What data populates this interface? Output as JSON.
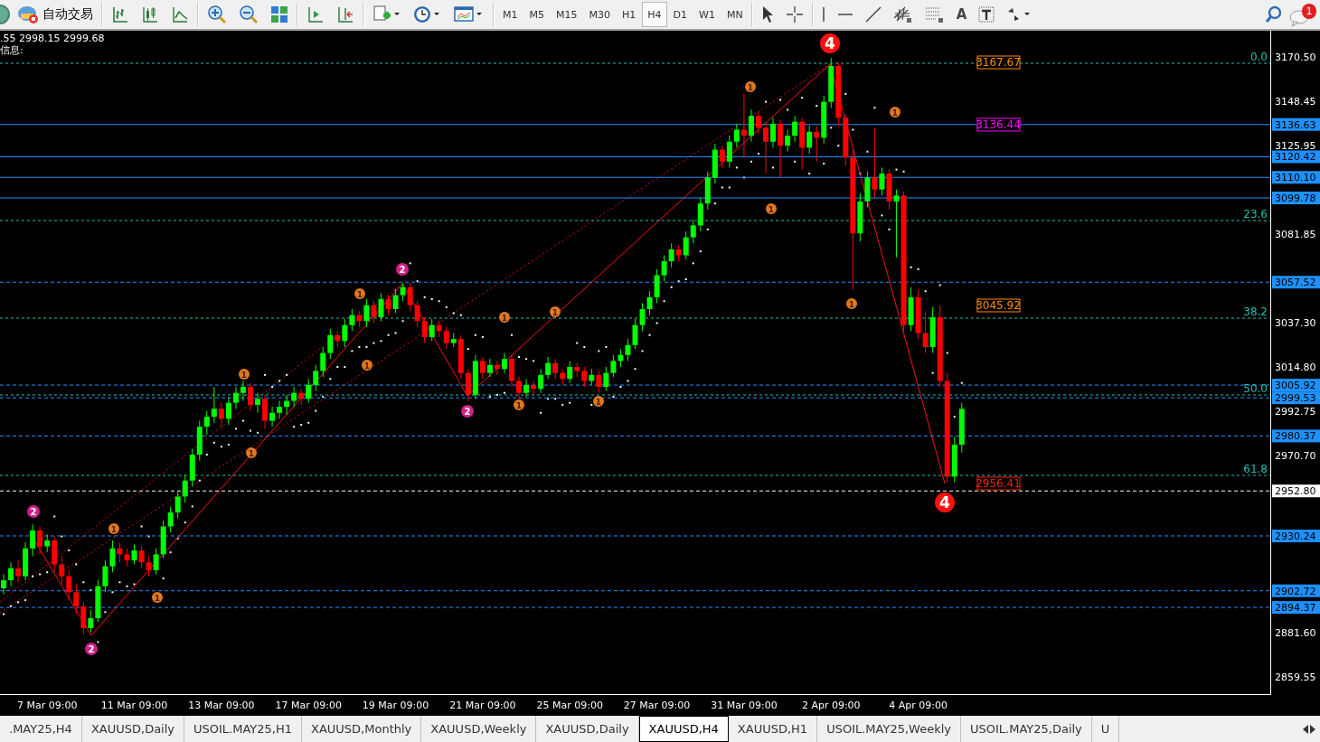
{
  "toolbar": {
    "auto_trade_label": "自动交易",
    "timeframes": [
      {
        "label": "M1",
        "selected": false
      },
      {
        "label": "M5",
        "selected": false
      },
      {
        "label": "M15",
        "selected": false
      },
      {
        "label": "M30",
        "selected": false
      },
      {
        "label": "H1",
        "selected": false
      },
      {
        "label": "H4",
        "selected": true
      },
      {
        "label": "D1",
        "selected": false
      },
      {
        "label": "W1",
        "selected": false
      },
      {
        "label": "MN",
        "selected": false
      }
    ],
    "text_tool_label": "A",
    "notification_count": "1"
  },
  "chart": {
    "info_line": ".55 2998.15 2999.68",
    "info_label": "信息:",
    "chart_data": {
      "type": "candlestick",
      "ylim": [
        2850.9,
        3183.65
      ],
      "categories": [
        null,
        null,
        null,
        null,
        null,
        null,
        "7 Mar 09:00",
        null,
        null,
        null,
        null,
        null,
        null,
        null,
        null,
        null,
        null,
        null,
        "11 Mar 09:00",
        null,
        null,
        null,
        null,
        null,
        null,
        null,
        null,
        null,
        null,
        null,
        "13 Mar 09:00",
        null,
        null,
        null,
        null,
        null,
        null,
        null,
        null,
        null,
        null,
        null,
        "17 Mar 09:00",
        null,
        null,
        null,
        null,
        null,
        null,
        null,
        null,
        null,
        null,
        null,
        "19 Mar 09:00",
        null,
        null,
        null,
        null,
        null,
        null,
        null,
        null,
        null,
        null,
        null,
        "21 Mar 09:00",
        null,
        null,
        null,
        null,
        null,
        null,
        null,
        null,
        null,
        null,
        null,
        "25 Mar 09:00",
        null,
        null,
        null,
        null,
        null,
        null,
        null,
        null,
        null,
        null,
        null,
        "27 Mar 09:00",
        null,
        null,
        null,
        null,
        null,
        null,
        null,
        null,
        null,
        null,
        null,
        "31 Mar 09:00",
        null,
        null,
        null,
        null,
        null,
        null,
        null,
        null,
        null,
        null,
        null,
        "2 Apr 09:00",
        null,
        null,
        null,
        null,
        null,
        null,
        null,
        null,
        null,
        null,
        null,
        "4 Apr 09:00",
        null,
        null,
        null,
        null,
        null,
        null,
        null,
        null,
        null,
        null,
        null,
        null,
        null,
        null,
        null,
        null,
        null,
        null,
        null,
        null,
        null,
        null,
        null,
        null,
        null,
        null,
        null,
        null,
        null,
        null,
        null,
        null,
        null,
        null,
        null,
        null,
        null,
        null,
        null,
        null,
        null,
        null,
        null,
        null,
        null,
        null,
        null,
        null
      ],
      "yticks": [
        {
          "value": 3170.5,
          "label": "3170.50"
        },
        {
          "value": 3148.45,
          "label": "3148.45"
        },
        {
          "value": 3125.95,
          "label": "3125.95"
        },
        {
          "value": 3081.85,
          "label": "3081.85"
        },
        {
          "value": 3037.3,
          "label": "3037.30"
        },
        {
          "value": 3014.8,
          "label": "3014.80"
        },
        {
          "value": 2992.75,
          "label": "2992.75"
        },
        {
          "value": 2970.7,
          "label": "2970.70"
        },
        {
          "value": 2881.6,
          "label": "2881.60"
        },
        {
          "value": 2859.55,
          "label": "2859.55"
        }
      ],
      "ohlc": [
        [
          2904,
          2911,
          2901,
          2908
        ],
        [
          2908,
          2917,
          2905,
          2914
        ],
        [
          2914,
          2918,
          2907,
          2910
        ],
        [
          2910,
          2927,
          2908,
          2924
        ],
        [
          2924,
          2936,
          2920,
          2933
        ],
        [
          2933,
          2935,
          2921,
          2925
        ],
        [
          2925,
          2931,
          2922,
          2928
        ],
        [
          2928,
          2930,
          2912,
          2916
        ],
        [
          2916,
          2920,
          2906,
          2910
        ],
        [
          2910,
          2913,
          2898,
          2902
        ],
        [
          2902,
          2906,
          2891,
          2895
        ],
        [
          2895,
          2897,
          2881,
          2884
        ],
        [
          2884,
          2893,
          2882,
          2889
        ],
        [
          2889,
          2908,
          2887,
          2905
        ],
        [
          2905,
          2918,
          2902,
          2915
        ],
        [
          2915,
          2928,
          2912,
          2924
        ],
        [
          2924,
          2927,
          2917,
          2921
        ],
        [
          2921,
          2924,
          2915,
          2918
        ],
        [
          2918,
          2926,
          2916,
          2923
        ],
        [
          2923,
          2925,
          2914,
          2917
        ],
        [
          2917,
          2920,
          2910,
          2913
        ],
        [
          2913,
          2924,
          2911,
          2921
        ],
        [
          2921,
          2938,
          2919,
          2935
        ],
        [
          2935,
          2945,
          2932,
          2942
        ],
        [
          2942,
          2953,
          2939,
          2950
        ],
        [
          2950,
          2961,
          2947,
          2958
        ],
        [
          2958,
          2974,
          2955,
          2971
        ],
        [
          2971,
          2988,
          2968,
          2985
        ],
        [
          2985,
          2993,
          2981,
          2990
        ],
        [
          2990,
          3005,
          2987,
          2994
        ],
        [
          2994,
          2997,
          2985,
          2989
        ],
        [
          2989,
          3000,
          2986,
          2997
        ],
        [
          2997,
          3005,
          2994,
          3002
        ],
        [
          3002,
          3008,
          2998,
          3005
        ],
        [
          3005,
          3007,
          2993,
          2996
        ],
        [
          2996,
          3002,
          2992,
          2999
        ],
        [
          2999,
          3001,
          2984,
          2988
        ],
        [
          2988,
          2995,
          2985,
          2992
        ],
        [
          2992,
          2998,
          2989,
          2995
        ],
        [
          2995,
          3001,
          2991,
          2998
        ],
        [
          2998,
          3005,
          2995,
          3002
        ],
        [
          3002,
          3004,
          2996,
          2999
        ],
        [
          2999,
          3009,
          2997,
          3006
        ],
        [
          3006,
          3016,
          3003,
          3013
        ],
        [
          3013,
          3025,
          3010,
          3022
        ],
        [
          3022,
          3034,
          3019,
          3031
        ],
        [
          3031,
          3033,
          3025,
          3028
        ],
        [
          3028,
          3039,
          3025,
          3036
        ],
        [
          3036,
          3044,
          3033,
          3041
        ],
        [
          3041,
          3043,
          3035,
          3038
        ],
        [
          3038,
          3049,
          3035,
          3046
        ],
        [
          3046,
          3048,
          3037,
          3040
        ],
        [
          3040,
          3052,
          3038,
          3049
        ],
        [
          3049,
          3051,
          3041,
          3044
        ],
        [
          3044,
          3054,
          3042,
          3051
        ],
        [
          3051,
          3057,
          3048,
          3055
        ],
        [
          3055,
          3057,
          3043,
          3046
        ],
        [
          3046,
          3048,
          3035,
          3038
        ],
        [
          3038,
          3040,
          3027,
          3030
        ],
        [
          3030,
          3039,
          3028,
          3036
        ],
        [
          3036,
          3038,
          3030,
          3033
        ],
        [
          3033,
          3035,
          3024,
          3027
        ],
        [
          3027,
          3032,
          3025,
          3029
        ],
        [
          3029,
          3031,
          3009,
          3012
        ],
        [
          3012,
          3014,
          2998,
          3001
        ],
        [
          3001,
          3021,
          2999,
          3018
        ],
        [
          3018,
          3020,
          3009,
          3012
        ],
        [
          3012,
          3019,
          3010,
          3016
        ],
        [
          3016,
          3018,
          3011,
          3014
        ],
        [
          3014,
          3022,
          3012,
          3019
        ],
        [
          3019,
          3021,
          3005,
          3008
        ],
        [
          3008,
          3010,
          2999,
          3002
        ],
        [
          3002,
          3009,
          3000,
          3006
        ],
        [
          3006,
          3008,
          3001,
          3004
        ],
        [
          3004,
          3014,
          3002,
          3011
        ],
        [
          3011,
          3020,
          3009,
          3017
        ],
        [
          3017,
          3019,
          3009,
          3012
        ],
        [
          3012,
          3014,
          3006,
          3009
        ],
        [
          3009,
          3018,
          3007,
          3015
        ],
        [
          3015,
          3017,
          3010,
          3013
        ],
        [
          3013,
          3015,
          3005,
          3008
        ],
        [
          3008,
          3014,
          3006,
          3011
        ],
        [
          3011,
          3013,
          3002,
          3005
        ],
        [
          3005,
          3015,
          3003,
          3012
        ],
        [
          3012,
          3021,
          3010,
          3018
        ],
        [
          3018,
          3024,
          3015,
          3021
        ],
        [
          3021,
          3029,
          3018,
          3026
        ],
        [
          3026,
          3039,
          3024,
          3036
        ],
        [
          3036,
          3047,
          3033,
          3044
        ],
        [
          3044,
          3053,
          3041,
          3050
        ],
        [
          3050,
          3064,
          3047,
          3061
        ],
        [
          3061,
          3071,
          3058,
          3068
        ],
        [
          3068,
          3077,
          3065,
          3074
        ],
        [
          3074,
          3076,
          3068,
          3071
        ],
        [
          3071,
          3083,
          3069,
          3080
        ],
        [
          3080,
          3089,
          3077,
          3086
        ],
        [
          3086,
          3100,
          3083,
          3097
        ],
        [
          3097,
          3113,
          3094,
          3110
        ],
        [
          3110,
          3127,
          3107,
          3124
        ],
        [
          3124,
          3126,
          3115,
          3118
        ],
        [
          3118,
          3131,
          3115,
          3128
        ],
        [
          3128,
          3137,
          3125,
          3134
        ],
        [
          3134,
          3152,
          3120,
          3131
        ],
        [
          3131,
          3144,
          3128,
          3141
        ],
        [
          3141,
          3143,
          3132,
          3135
        ],
        [
          3135,
          3138,
          3112,
          3128
        ],
        [
          3128,
          3140,
          3125,
          3137
        ],
        [
          3137,
          3139,
          3110,
          3126
        ],
        [
          3126,
          3134,
          3123,
          3131
        ],
        [
          3131,
          3141,
          3128,
          3138
        ],
        [
          3138,
          3140,
          3114,
          3125
        ],
        [
          3125,
          3136,
          3122,
          3133
        ],
        [
          3133,
          3136,
          3118,
          3130
        ],
        [
          3130,
          3151,
          3127,
          3148
        ],
        [
          3148,
          3170,
          3145,
          3166
        ],
        [
          3166,
          3168,
          3136,
          3140
        ],
        [
          3140,
          3142,
          3116,
          3120
        ],
        [
          3120,
          3124,
          3054,
          3082
        ],
        [
          3082,
          3102,
          3078,
          3098
        ],
        [
          3098,
          3113,
          3095,
          3110
        ],
        [
          3110,
          3135,
          3100,
          3104
        ],
        [
          3104,
          3115,
          3101,
          3112
        ],
        [
          3112,
          3114,
          3094,
          3098
        ],
        [
          3098,
          3104,
          3070,
          3101
        ],
        [
          3101,
          3103,
          3033,
          3036
        ],
        [
          3036,
          3055,
          3033,
          3050
        ],
        [
          3050,
          3054,
          3029,
          3032
        ],
        [
          3032,
          3043,
          3022,
          3025
        ],
        [
          3025,
          3045,
          3022,
          3040
        ],
        [
          3040,
          3046,
          3005,
          3008
        ],
        [
          3008,
          3012,
          2957,
          2960
        ],
        [
          2960,
          2980,
          2957,
          2976
        ],
        [
          2976,
          2997,
          2972,
          2994
        ],
        null,
        null,
        null,
        null,
        null,
        null,
        null,
        null,
        null,
        null,
        null,
        null,
        null,
        null,
        null,
        null,
        null,
        null,
        null,
        null,
        null,
        null,
        null,
        null,
        null,
        null,
        null,
        null,
        null,
        null,
        null,
        null,
        null,
        null,
        null,
        null,
        null,
        null,
        null,
        null,
        null,
        null
      ]
    },
    "levels": [
      {
        "price": "3136.63",
        "kind": "solid"
      },
      {
        "price": "3120.42",
        "kind": "solid"
      },
      {
        "price": "3110.10",
        "kind": "solid"
      },
      {
        "price": "3099.78",
        "kind": "solid"
      },
      {
        "price": "3057.52",
        "kind": "dashed"
      },
      {
        "price": "3005.92",
        "kind": "dashed"
      },
      {
        "price": "2999.53",
        "kind": "dashed"
      },
      {
        "price": "2980.37",
        "kind": "dashed"
      },
      {
        "price": "2952.80",
        "kind": "current"
      },
      {
        "price": "2930.24",
        "kind": "dashed"
      },
      {
        "price": "2902.72",
        "kind": "dashed"
      },
      {
        "price": "2894.37",
        "kind": "dashed"
      }
    ],
    "fib_levels": [
      "0.0",
      "23.6",
      "38.2",
      "50.0",
      "61.8"
    ],
    "price_tags": [
      {
        "text": "3167.67",
        "color": "#ff8c00"
      },
      {
        "text": "3136.44",
        "color": "#ff00ff"
      },
      {
        "text": "3045.92",
        "color": "#ff8c00"
      },
      {
        "text": "2956.41",
        "color": "#ff2000"
      }
    ],
    "wave_markers": [
      {
        "label": "4",
        "kind": "major"
      },
      {
        "label": "4",
        "kind": "major"
      },
      {
        "label": "2",
        "kind": "mid"
      },
      {
        "label": "2",
        "kind": "mid"
      },
      {
        "label": "2",
        "kind": "mid"
      },
      {
        "label": "2",
        "kind": "mid"
      },
      {
        "label": "1",
        "kind": "minor"
      },
      {
        "label": "1",
        "kind": "minor"
      },
      {
        "label": "1",
        "kind": "minor"
      },
      {
        "label": "1",
        "kind": "minor"
      },
      {
        "label": "1",
        "kind": "minor"
      },
      {
        "label": "1",
        "kind": "minor"
      },
      {
        "label": "1",
        "kind": "minor"
      },
      {
        "label": "1",
        "kind": "minor"
      },
      {
        "label": "1",
        "kind": "minor"
      },
      {
        "label": "1",
        "kind": "minor"
      },
      {
        "label": "1",
        "kind": "minor"
      },
      {
        "label": "1",
        "kind": "minor"
      },
      {
        "label": "1",
        "kind": "minor"
      },
      {
        "label": "1",
        "kind": "minor"
      }
    ]
  },
  "tabs": [
    {
      "label": ".MAY25,H4",
      "selected": false
    },
    {
      "label": "XAUUSD,Daily",
      "selected": false
    },
    {
      "label": "USOIL.MAY25,H1",
      "selected": false
    },
    {
      "label": "XAUUSD,Monthly",
      "selected": false
    },
    {
      "label": "XAUUSD,Weekly",
      "selected": false
    },
    {
      "label": "XAUUSD,Daily",
      "selected": false
    },
    {
      "label": "XAUUSD,H4",
      "selected": true
    },
    {
      "label": "XAUUSD,H1",
      "selected": false
    },
    {
      "label": "USOIL.MAY25,Weekly",
      "selected": false
    },
    {
      "label": "USOIL.MAY25,Daily",
      "selected": false
    },
    {
      "label": "U",
      "selected": false
    }
  ]
}
